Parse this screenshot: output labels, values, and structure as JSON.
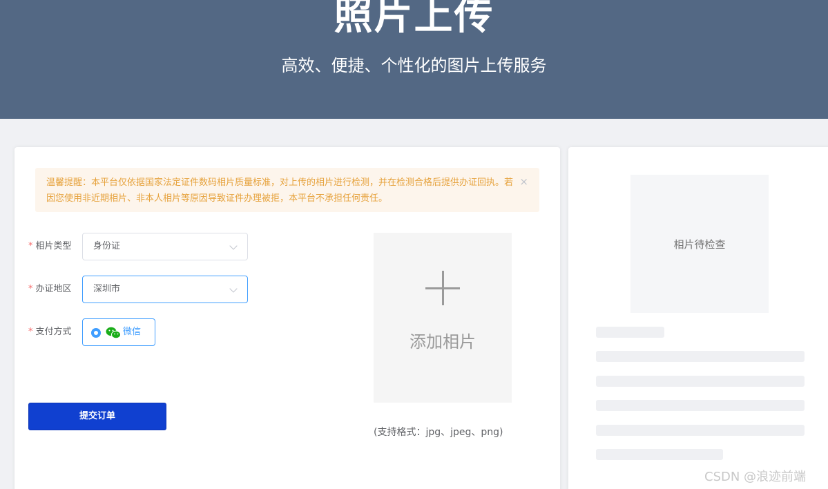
{
  "header": {
    "title": "照片上传",
    "subtitle": "高效、便捷、个性化的图片上传服务"
  },
  "notice": {
    "text": "温馨提醒：本平台仅依据国家法定证件数码相片质量标准，对上传的相片进行检测，并在检测合格后提供办证回执。若因您使用非近期相片、非本人相片等原因导致证件办理被拒，本平台不承担任何责任。",
    "close_icon": "close-icon",
    "close_glyph": "×"
  },
  "form": {
    "required_mark": "*",
    "photo_type": {
      "label": "相片类型",
      "value": "身份证"
    },
    "region": {
      "label": "办证地区",
      "value": "深圳市"
    },
    "payment": {
      "label": "支付方式",
      "option": "微信",
      "selected": true,
      "icon": "wechat-icon"
    },
    "submit_label": "提交订单"
  },
  "upload": {
    "add_label": "添加相片",
    "format_hint": "(支持格式：jpg、jpeg、png)",
    "icon": "plus-icon"
  },
  "preview": {
    "placeholder": "相片待检查"
  },
  "watermark": "CSDN @浪迹前端",
  "colors": {
    "header_bg": "#536884",
    "primary_button": "#1040d0",
    "accent": "#409eff",
    "warning_text": "#e6a23c",
    "warning_bg": "#fdf5ec",
    "required": "#f56c6c",
    "wechat_green": "#1aad19"
  }
}
